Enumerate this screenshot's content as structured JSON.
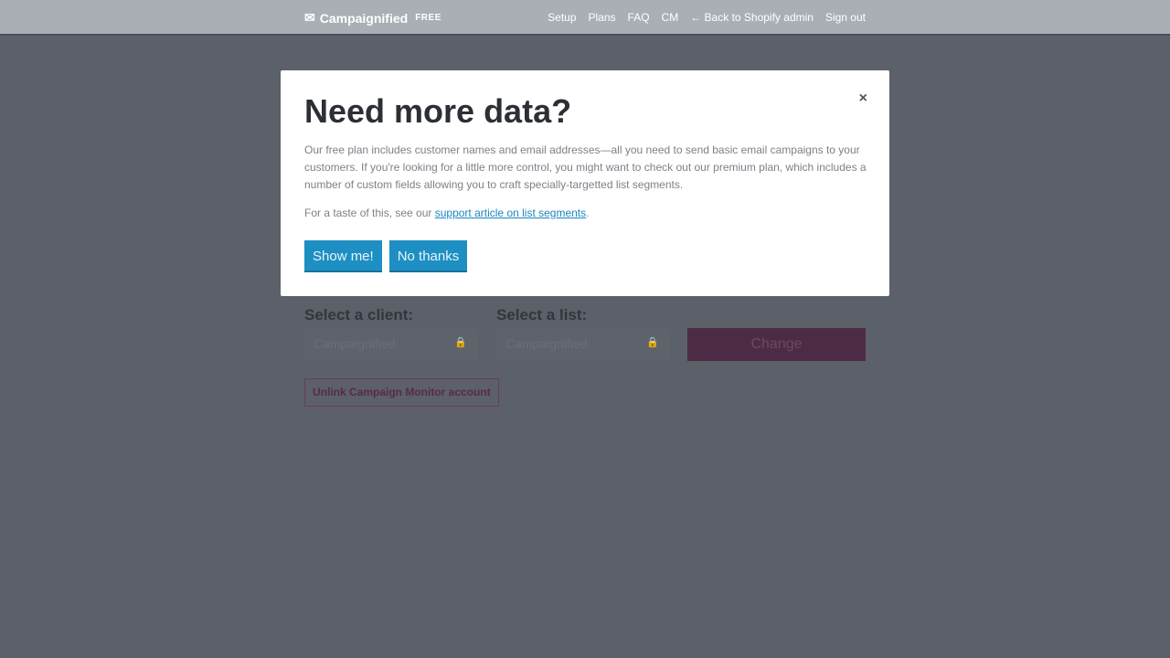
{
  "header": {
    "brand": "Campaignified",
    "plan_badge": "FREE",
    "nav": [
      "Setup",
      "Plans",
      "FAQ",
      "CM",
      "← Back to Shopify admin",
      "Sign out"
    ]
  },
  "background": {
    "client_label": "Select a client:",
    "client_value": "Campaignified",
    "list_label": "Select a list:",
    "list_value": "Campaignified",
    "change_label": "Change",
    "unlink_label": "Unlink Campaign Monitor account"
  },
  "modal": {
    "title": "Need more data?",
    "close": "×",
    "body": "Our free plan includes customer names and email addresses—all you need to send basic email campaigns to your customers. If you're looking for a little more control, you might want to check out our premium plan, which includes a number of custom fields allowing you to craft specially-targetted list segments.",
    "taste_prefix": "For a taste of this, see our ",
    "taste_link": "support article on list segments",
    "taste_suffix": ".",
    "show_me": "Show me!",
    "no_thanks": "No thanks"
  }
}
